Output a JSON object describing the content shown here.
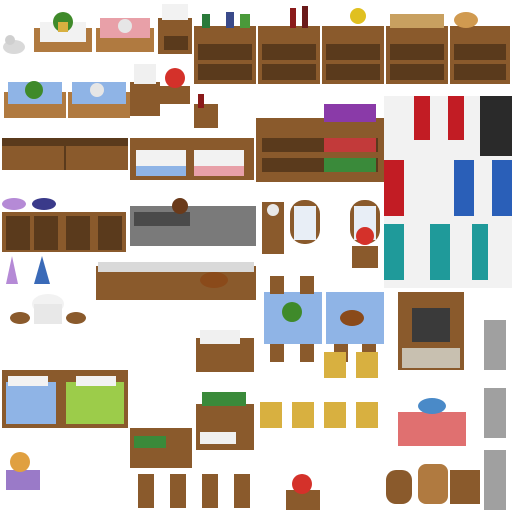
{
  "sheet": {
    "name": "",
    "background": "#ffffff",
    "palette": {
      "wood_dark": "#5a3a1c",
      "wood_mid": "#8a5a2c",
      "wood_light": "#b07a40",
      "cloth_white": "#f2f2f2",
      "cloth_pink": "#e8a0a8",
      "cloth_blue": "#8fb4e6",
      "cloth_green": "#9ccc4a",
      "curtain_red": "#c21c24",
      "curtain_blue": "#2a5fb8",
      "curtain_teal": "#1f9a9a",
      "curtain_black": "#2a2a2a",
      "stone_gray": "#8a8a8a",
      "plant_green": "#3f8a2a",
      "flower_red": "#d4312a",
      "gold": "#d8b040"
    },
    "tile_types": [
      "table-white-cloth-plant",
      "table-pink-cloth-teapot",
      "tea-set",
      "small-cabinet",
      "bottle-shelf",
      "book-shelf",
      "dish-shelf",
      "bread-shelf",
      "curtain-red",
      "curtain-white",
      "curtain-blue",
      "curtain-teal",
      "curtain-black",
      "bench",
      "sofa-white-cushions",
      "wardrobe",
      "dress-stand",
      "stove",
      "window-arched",
      "grandfather-clock",
      "round-table",
      "stool",
      "dining-table-food",
      "chair",
      "fireplace",
      "statue",
      "bed-double",
      "desk-with-papers",
      "portrait-frame",
      "altar-table",
      "barrel",
      "wooden-crate",
      "flower-pot"
    ]
  }
}
